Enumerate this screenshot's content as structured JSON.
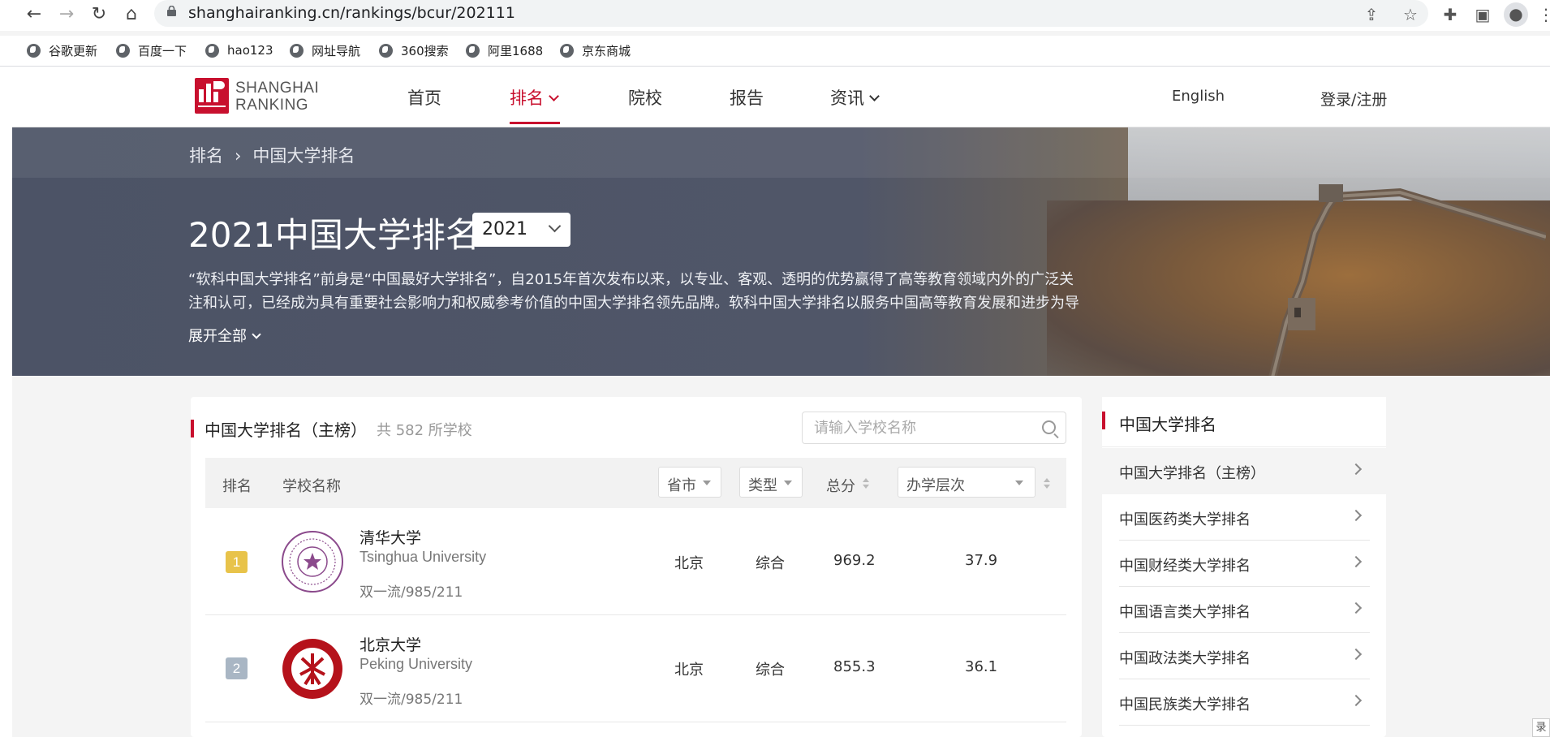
{
  "browser": {
    "url": "shanghairanking.cn/rankings/bcur/202111",
    "bookmarks": [
      "谷歌更新",
      "百度一下",
      "hao123",
      "网址导航",
      "360搜索",
      "阿里1688",
      "京东商城"
    ]
  },
  "site": {
    "logo_line1": "SHANGHAI",
    "logo_line2": "RANKING",
    "menu": [
      "首页",
      "排名",
      "院校",
      "报告",
      "资讯"
    ],
    "english": "English",
    "login": "登录/注册"
  },
  "hero": {
    "breadcrumb": [
      "排名",
      "中国大学排名"
    ],
    "title": "2021中国大学排名",
    "year": "2021",
    "intro": "“软科中国大学排名”前身是“中国最好大学排名”，自2015年首次发布以来，以专业、客观、透明的优势赢得了高等教育领域内外的广泛关注和认可，已经成为具有重要社会影响力和权威参考价值的中国大学排名领先品牌。软科中国大学排名以服务中国高等教育发展和进步为导",
    "expand": "展开全部"
  },
  "ranking": {
    "title": "中国大学排名（主榜）",
    "count": "共 582 所学校",
    "search_placeholder": "请输入学校名称",
    "headers": {
      "rank": "排名",
      "name": "学校名称",
      "province": "省市",
      "type": "类型",
      "score": "总分",
      "level": "办学层次"
    },
    "rows": [
      {
        "rank": "1",
        "cn": "清华大学",
        "en": "Tsinghua University",
        "tags": "双一流/985/211",
        "province": "北京",
        "type": "综合",
        "score": "969.2",
        "level": "37.9"
      },
      {
        "rank": "2",
        "cn": "北京大学",
        "en": "Peking University",
        "tags": "双一流/985/211",
        "province": "北京",
        "type": "综合",
        "score": "855.3",
        "level": "36.1"
      }
    ]
  },
  "sidebar": {
    "title": "中国大学排名",
    "items": [
      "中国大学排名（主榜）",
      "中国医药类大学排名",
      "中国财经类大学排名",
      "中国语言类大学排名",
      "中国政法类大学排名",
      "中国民族类大学排名"
    ]
  },
  "corner_tab": "录",
  "colors": {
    "accent": "#c8102e",
    "gold": "#e8c34a",
    "silver": "#a9b6c4"
  }
}
